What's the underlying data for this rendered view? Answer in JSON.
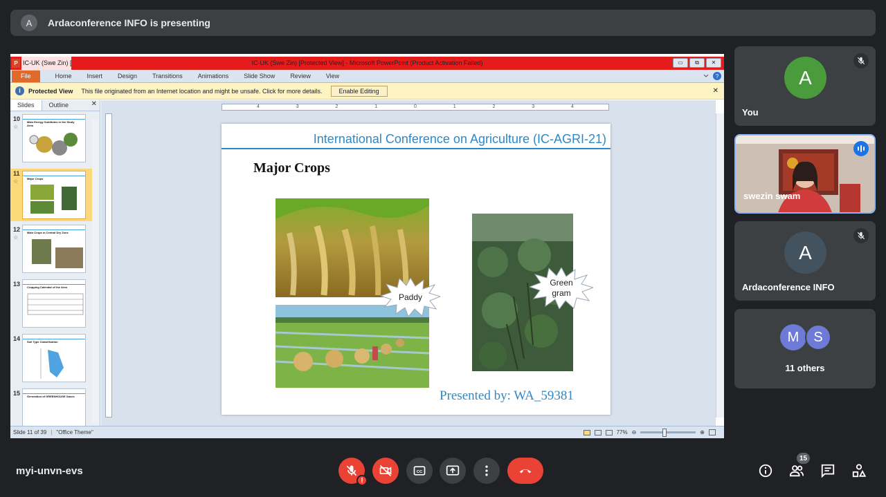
{
  "banner": {
    "avatar_letter": "A",
    "text": "Ardaconference INFO is presenting"
  },
  "ppt": {
    "app_icon": "P",
    "title_left": "IC-UK (Swe Zin) [I",
    "window_title": "IC-UK (Swe Zin) [Protected View] - Microsoft PowerPoint (Product Activation Failed)",
    "window_buttons": [
      "▭",
      "⧉",
      "✕"
    ],
    "tabs": [
      "File",
      "Home",
      "Insert",
      "Design",
      "Transitions",
      "Animations",
      "Slide Show",
      "Review",
      "View"
    ],
    "protected_view": {
      "icon_glyph": "i",
      "label": "Protected View",
      "message": "This file originated from an Internet location and might be unsafe. Click for more details.",
      "button": "Enable Editing",
      "close_glyph": "✕"
    },
    "pane_tabs": [
      "Slides",
      "Outline"
    ],
    "pane_close_glyph": "✕",
    "thumbnails": [
      {
        "num": "10",
        "title": "Main Energy Subtitutes in the Study Area",
        "selected": false
      },
      {
        "num": "11",
        "title": "Major Crops",
        "selected": true
      },
      {
        "num": "12",
        "title": "Main Crops in Central Dry Zone",
        "selected": false
      },
      {
        "num": "13",
        "title": "Cropping Calendar of the Area",
        "selected": false
      },
      {
        "num": "14",
        "title": "Soil Type Classification",
        "selected": false
      },
      {
        "num": "15",
        "title": "Generation of GREENHOUSE Gases",
        "selected": false
      }
    ],
    "ruler_marks": [
      "4",
      "3",
      "2",
      "1",
      "0",
      "1",
      "2",
      "3",
      "4"
    ],
    "status": {
      "slide_info": "Slide 11 of 39",
      "theme": "\"Office Theme\"",
      "zoom": "77%"
    },
    "slide": {
      "conference": "International Conference on Agriculture (IC-AGRI-21)",
      "heading": "Major Crops",
      "label_paddy": "Paddy",
      "label_green_line1": "Green",
      "label_green_line2": "gram",
      "presenter": "Presented by:   WA_59381"
    }
  },
  "participants": [
    {
      "id": "you",
      "letter": "A",
      "name": "You",
      "avatar_color": "#4a9b3c",
      "mic_icon": "mic-off-icon"
    },
    {
      "id": "swezin",
      "name": "swezin swam",
      "speaking": true
    },
    {
      "id": "ardaconference",
      "letter": "A",
      "name": "Ardaconference INFO",
      "avatar_color": "#42525e",
      "mic_icon": "mic-off-icon"
    },
    {
      "id": "others",
      "letters": [
        "M",
        "S"
      ],
      "name": "11 others",
      "avatar_color": "#6d7bd6"
    }
  ],
  "meeting": {
    "code": "myi-unvn-evs",
    "controls": [
      "mic-off-icon",
      "camera-off-icon",
      "captions-icon",
      "present-icon",
      "more-icon",
      "end-call-icon"
    ],
    "right_icons": [
      "info-icon",
      "people-icon",
      "chat-icon",
      "activities-icon"
    ],
    "people_count": "15",
    "colors": {
      "danger": "#ea4335",
      "surface": "#3c4043",
      "background": "#202124"
    }
  }
}
